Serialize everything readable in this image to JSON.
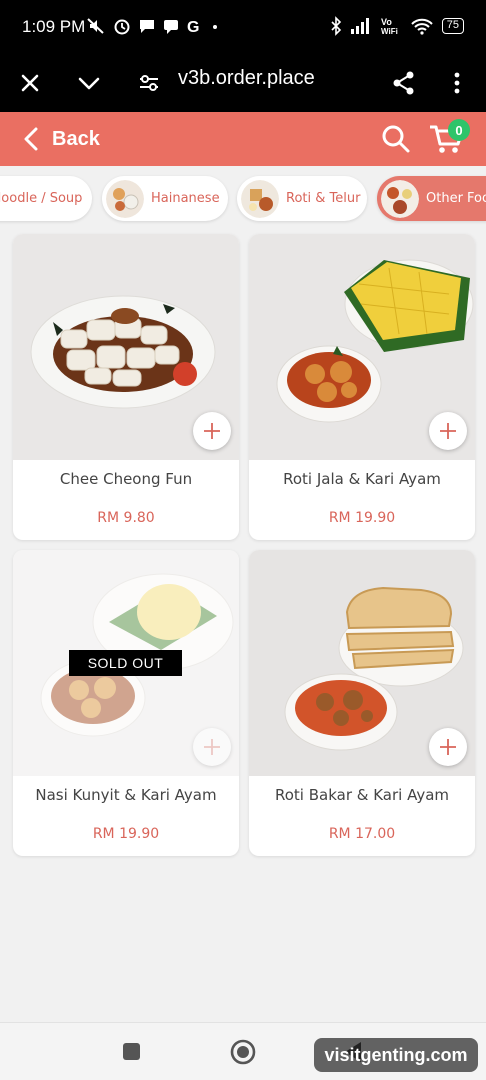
{
  "status_bar": {
    "time": "1:09 PM",
    "battery": "75",
    "network": "Vo WiFi"
  },
  "browser": {
    "url": "v3b.order.place"
  },
  "header": {
    "back_label": "Back",
    "cart_count": "0",
    "accent_color": "#ea6f62"
  },
  "categories": [
    {
      "label": "Noodle / Soup",
      "active": false
    },
    {
      "label": "Hainanese",
      "active": false
    },
    {
      "label": "Roti & Telur",
      "active": false
    },
    {
      "label": "Other Food",
      "active": true
    }
  ],
  "products": [
    {
      "name": "Chee Cheong Fun",
      "price": "RM 9.80",
      "sold_out": false
    },
    {
      "name": "Roti Jala & Kari Ayam",
      "price": "RM 19.90",
      "sold_out": false
    },
    {
      "name": "Nasi Kunyit & Kari Ayam",
      "price": "RM 19.90",
      "sold_out": true,
      "badge": "SOLD OUT"
    },
    {
      "name": "Roti Bakar & Kari Ayam",
      "price": "RM 17.00",
      "sold_out": false
    }
  ],
  "watermark": "visitgenting.com"
}
